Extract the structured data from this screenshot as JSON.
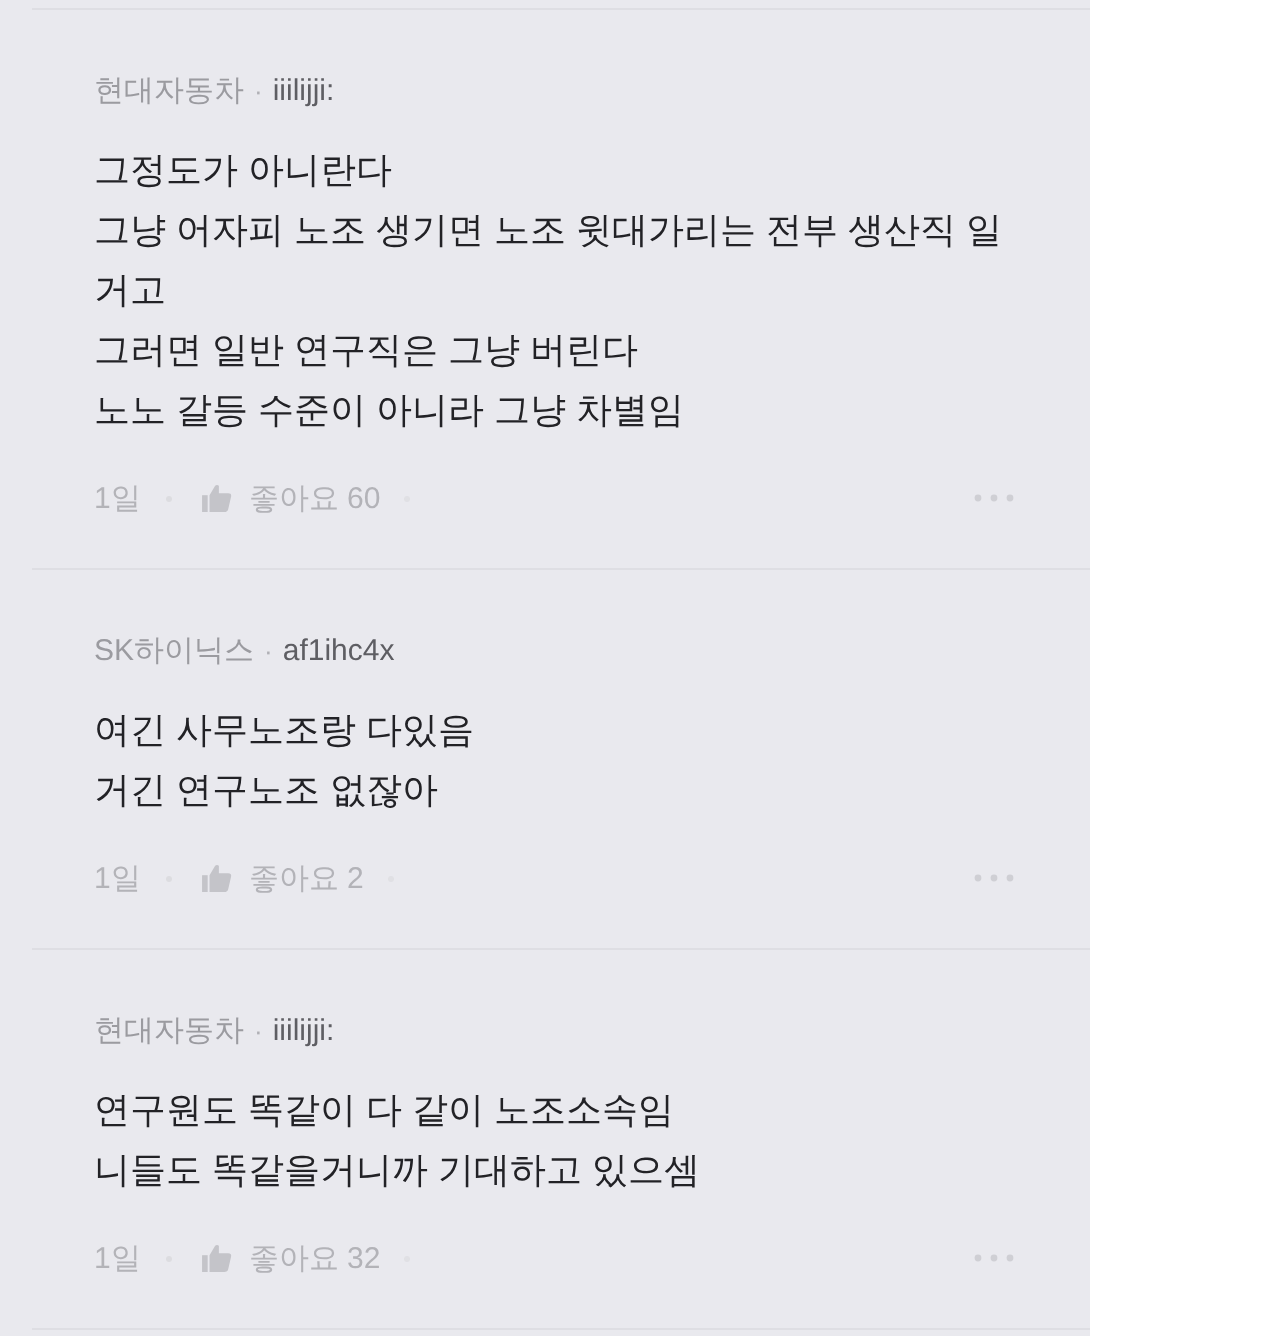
{
  "comments": [
    {
      "company": "현대자동차",
      "separator": "·",
      "username": "iiilijji:",
      "body": "그정도가 아니란다\n그냥 어자피 노조 생기면 노조 윗대가리는 전부 생산직 일 거고\n그러면 일반 연구직은 그냥 버린다\n노노 갈등 수준이 아니라 그냥 차별임",
      "time": "1일",
      "likes": "좋아요 60"
    },
    {
      "company": "SK하이닉스",
      "separator": "·",
      "username": "af1ihc4x",
      "body": "여긴 사무노조랑 다있음\n거긴 연구노조 없잖아",
      "time": "1일",
      "likes": "좋아요 2"
    },
    {
      "company": "현대자동차",
      "separator": "·",
      "username": "iiilijji:",
      "body": "연구원도 똑같이 다 같이 노조소속임\n니들도 똑같을거니까 기대하고 있으셈",
      "time": "1일",
      "likes": "좋아요 32"
    }
  ]
}
